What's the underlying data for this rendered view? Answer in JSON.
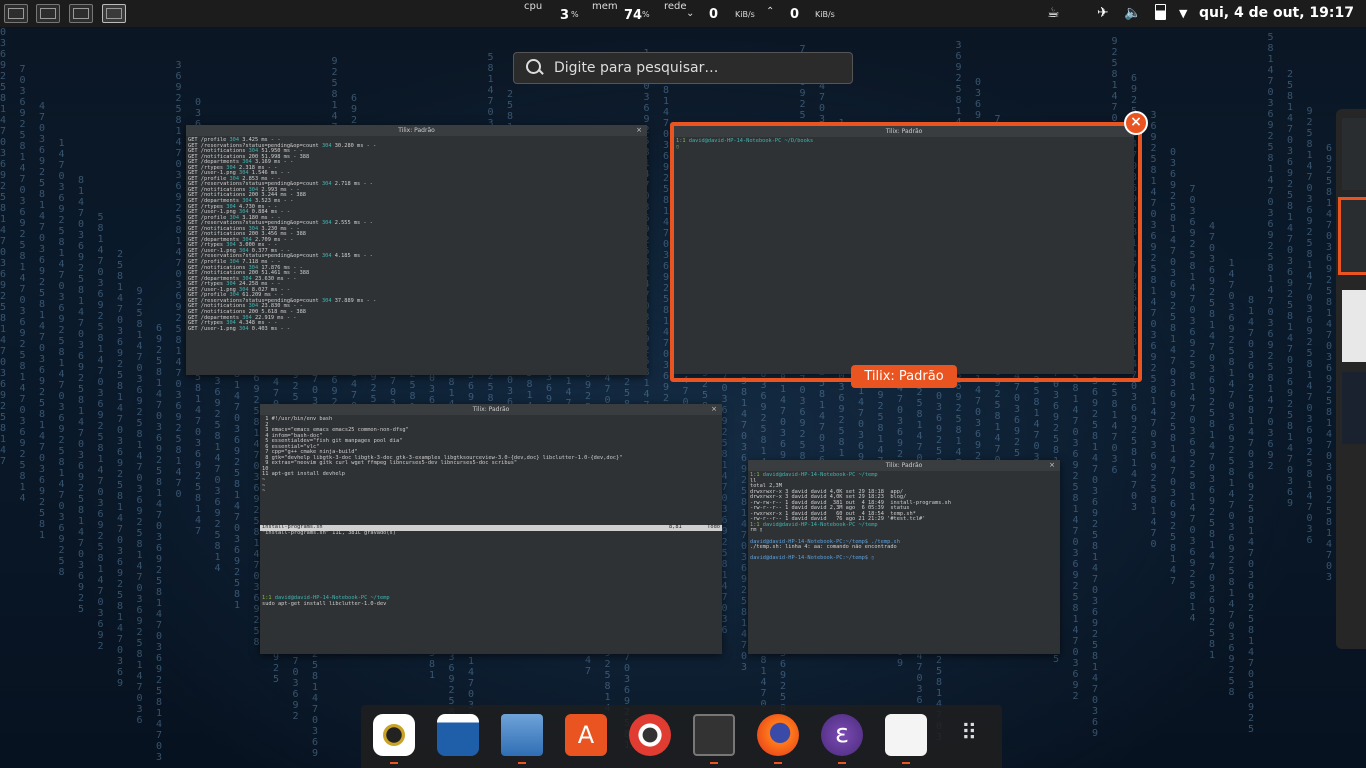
{
  "top_bar": {
    "workspaces": [
      "workspace-1",
      "workspace-2",
      "workspace-3",
      "workspace-4"
    ],
    "cpu_label": "cpu",
    "cpu_value": "3",
    "cpu_unit": "%",
    "mem_label": "mem",
    "mem_value": "74",
    "mem_unit": "%",
    "net_label": "rede",
    "down_value": "0",
    "down_unit": "KiB/s",
    "up_value": "0",
    "up_unit": "KiB/s",
    "clock": "qui,  4 de out, 19:17",
    "tray_icons": [
      "coffee-icon",
      "airplane-mode-icon",
      "volume-icon",
      "battery-icon",
      "menu-arrow-icon"
    ]
  },
  "search": {
    "placeholder": "Digite para pesquisar…"
  },
  "windows": {
    "w1": {
      "title": "Tilix: Padrão",
      "lines": [
        "GET /profile 304 3.425 ms - -",
        "GET /reservations?status=pending&op=count 304 30.280 ms - -",
        "GET /notifications 304 51.950 ms - -",
        "GET /notifications 200 51.998 ms - 388",
        "GET /departments 304 3.169 ms - -",
        "GET /rtypes 304 2.318 ms - -",
        "GET /user-1.png 304 1.546 ms - -",
        "GET /profile 304 2.853 ms - -",
        "GET /reservations?status=pending&op=count 304 2.718 ms - -",
        "GET /notifications 304 2.993 ms - -",
        "GET /notifications 200 3.244 ms - 388",
        "GET /departments 304 3.523 ms - -",
        "GET /rtypes 304 4.730 ms - -",
        "GET /user-1.png 304 0.884 ms - -",
        "GET /profile 304 3.180 ms - -",
        "GET /reservations?status=pending&op=count 304 2.555 ms - -",
        "GET /notifications 304 3.230 ms - -",
        "GET /notifications 200 3.456 ms - 388",
        "GET /departments 304 2.709 ms - -",
        "GET /rtypes 304 3.000 ms - -",
        "GET /user-1.png 304 0.377 ms - -",
        "GET /reservations?status=pending&op=count 304 4.185 ms - -",
        "GET /profile 304 7.118 ms - -",
        "GET /notifications 304 17.876 ms - -",
        "GET /notifications 200 51.461 ms - 388",
        "GET /departments 304 23.630 ms - -",
        "GET /rtypes 304 24.258 ms - -",
        "GET /user-1.png 304 8.027 ms - -",
        "GET /profile 304 61.209 ms - -",
        "GET /reservations?status=pending&op=count 304 37.889 ms - -",
        "GET /notifications 304 23.830 ms - -",
        "GET /notifications 200 5.618 ms - 388",
        "GET /departments 304 22.919 ms - -",
        "GET /rtypes 304 4.348 ms - -",
        "GET /user-1.png 304 0.403 ms - -"
      ]
    },
    "w2": {
      "title": "Tilix: Padrão",
      "prompt_tag": "1:1",
      "prompt": "david@david-HP-14-Notebook-PC ~/D/books",
      "cursor": "▯",
      "caption": "Tilix: Padrão"
    },
    "w3": {
      "title": "Tilix: Padrão",
      "editor_lines": [
        " 1 #!/usr/bin/env bash",
        " 2",
        " 3 emacs=\"emacs emacs emacs25 common-non-dfsg\"",
        " 4 infom=\"bash-doc\"",
        " 5 essentialdev=\"fish git manpages pool dia\"",
        " 6 essential=\"vlc\"",
        " 7 cpp=\"g++ cmake ninja-build\"",
        " 8 gtk=\"devhelp libgtk-3-doc libgtk-3-doc gtk-3-examples libgtksourceview-3.0-{dev,doc} libclutter-1.0-{dev,doc}\"",
        " 9 extras=\"neovim gitk curl wget ffmpeg libncurses5-dev libncurses5-doc scribus\"",
        "10",
        "11 apt-get install devhelp",
        "~",
        "~",
        "~"
      ],
      "status_left": "install-programs.sh",
      "status_right": "8,81        Todo",
      "message": "\"install-programs.sh\" 11L, 381C gravado(s)",
      "prompt_tag": "1:1",
      "prompt": "david@david-HP-14-Notebook-PC ~/temp",
      "command": "sudo apt-get install libclutter-1.0-dev"
    },
    "w4": {
      "title": "Tilix: Padrão",
      "prompt_tag": "1:1",
      "prompt1": "david@david-HP-14-Notebook-PC ~/temp",
      "cmd1": "ll",
      "listing": [
        "total 2,3M",
        "drwxrwxr-x 3 david david 4,0K set 29 18:18  app/",
        "drwxrwxr-x 3 david david 4,0K set 29 18:23  blog/",
        "-rw-rw-r-- 1 david david  381 out  4 18:49  install-programs.sh",
        "-rw-r--r-- 1 david david 2,3M ago  6 05:39  status",
        "-rwxrwxr-x 1 david david   60 out  4 18:54  temp.sh*",
        "-rw-r--r-- 1 david david   76 ago 21 21:29 '#test.tcl#'"
      ],
      "prompt2": "david@david-HP-14-Notebook-PC ~/temp",
      "cmd2": "rm ▯",
      "line_a": "david@david-HP-14-Notebook-PC:~/temp$ ./temp.sh",
      "line_b": "./temp.sh: linha 4: aa: comando não encontrado",
      "line_c": "david@david-HP-14-Notebook-PC:~/temp$ ▯"
    }
  },
  "dock": {
    "apps": [
      "rhythmbox-icon",
      "libreoffice-writer-icon",
      "files-icon",
      "software-center-icon",
      "help-icon",
      "tilix-icon",
      "firefox-icon",
      "emacs-icon",
      "evince-icon",
      "show-applications-icon"
    ],
    "running": [
      0,
      2,
      5,
      6,
      7,
      8
    ]
  },
  "colors": {
    "accent": "#e95420",
    "panel": "#1c1c1c"
  }
}
